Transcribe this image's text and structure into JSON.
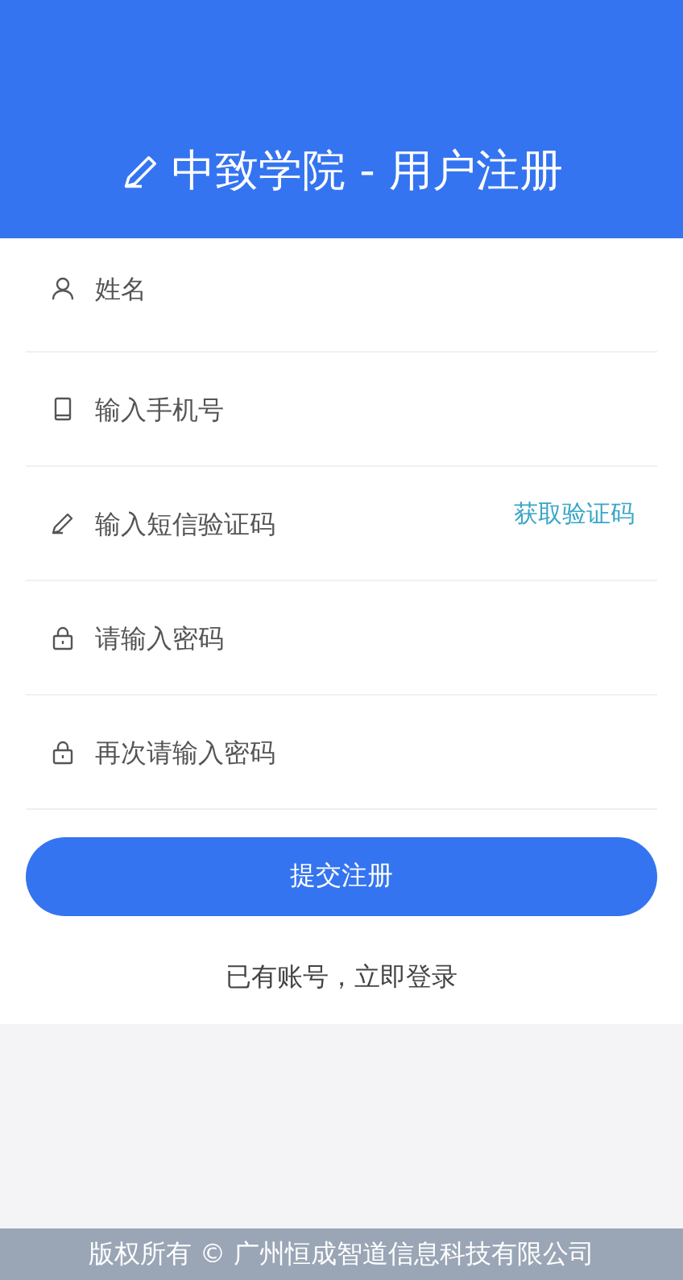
{
  "header": {
    "title": "中致学院 - 用户注册"
  },
  "fields": [
    {
      "kind": "user",
      "placeholder": "姓名"
    },
    {
      "kind": "phone",
      "placeholder": "输入手机号"
    },
    {
      "kind": "pencil",
      "placeholder": "输入短信验证码",
      "action": "获取验证码"
    },
    {
      "kind": "lock",
      "placeholder": "请输入密码"
    },
    {
      "kind": "lock",
      "placeholder": "再次请输入密码"
    }
  ],
  "submit": "提交注册",
  "login_link": "已有账号，立即登录",
  "footer": "版权所有 © 广州恒成智道信息科技有限公司"
}
